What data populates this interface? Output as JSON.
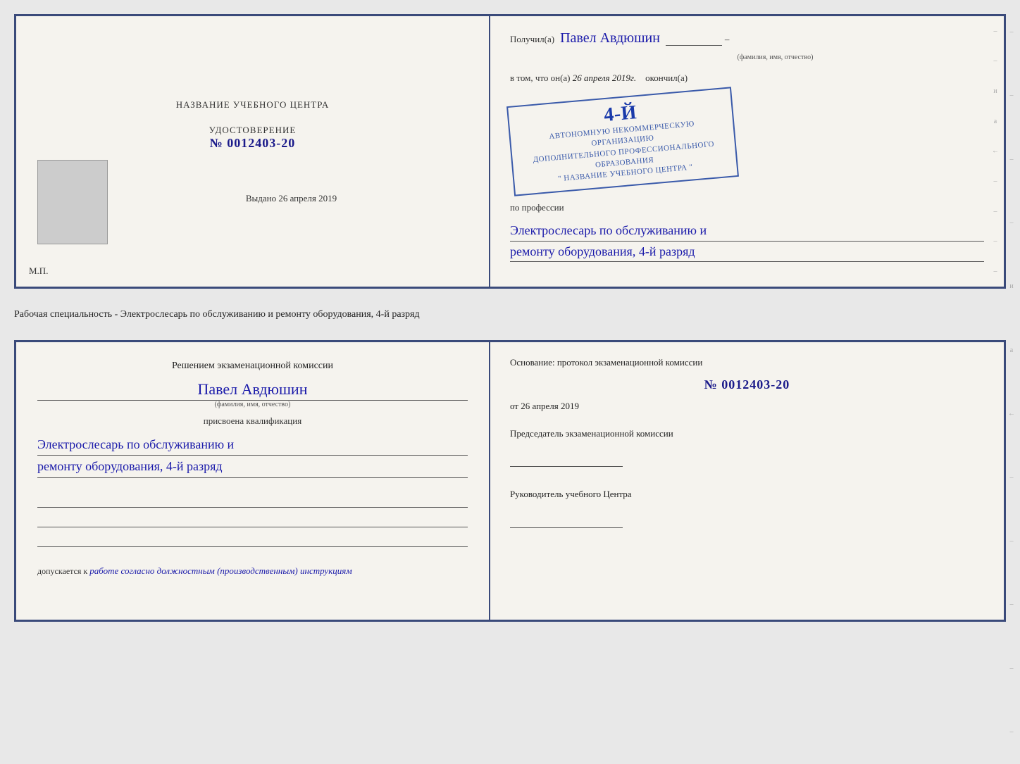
{
  "top_doc": {
    "left": {
      "title": "НАЗВАНИЕ УЧЕБНОГО ЦЕНТРА",
      "cert_label": "УДОСТОВЕРЕНИЕ",
      "cert_number": "№ 0012403-20",
      "issued_label": "Выдано",
      "issued_date": "26 апреля 2019",
      "mp": "М.П."
    },
    "right": {
      "received_label": "Получил(а)",
      "person_name": "Павел Авдюшин",
      "fio_label": "(фамилия, имя, отчество)",
      "vtom_label": "в том, что он(а)",
      "vtom_date": "26 апреля 2019г.",
      "okoncil_label": "окончил(а)",
      "stamp_line1": "АВТОНОМНУЮ НЕКОММЕРЧЕСКУЮ ОРГАНИЗАЦИЮ",
      "stamp_line2": "ДОПОЛНИТЕЛЬНОГО ПРОФЕССИОНАЛЬНОГО ОБРАЗОВАНИЯ",
      "stamp_center": "4-й",
      "stamp_line3": "\" НАЗВАНИЕ УЧЕБНОГО ЦЕНТРА \"",
      "profession_label": "по профессии",
      "profession_line1": "Электрослесарь по обслуживанию и",
      "profession_line2": "ремонту оборудования, 4-й разряд"
    }
  },
  "middle": {
    "text": "Рабочая специальность - Электрослесарь по обслуживанию и ремонту оборудования, 4-й разряд"
  },
  "bottom_doc": {
    "left": {
      "commission_title": "Решением экзаменационной комиссии",
      "person_name": "Павел Авдюшин",
      "fio_label": "(фамилия, имя, отчество)",
      "assigned_label": "присвоена квалификация",
      "qualification_line1": "Электрослесарь по обслуживанию и",
      "qualification_line2": "ремонту оборудования, 4-й разряд",
      "допускается_prefix": "допускается к",
      "допускается_text": "работе согласно должностным (производственным) инструкциям"
    },
    "right": {
      "osnov_label": "Основание: протокол экзаменационной комиссии",
      "protocol_number": "№ 0012403-20",
      "protocol_date_prefix": "от",
      "protocol_date": "26 апреля 2019",
      "chairman_label": "Председатель экзаменационной комиссии",
      "director_label": "Руководитель учебного Центра"
    }
  }
}
